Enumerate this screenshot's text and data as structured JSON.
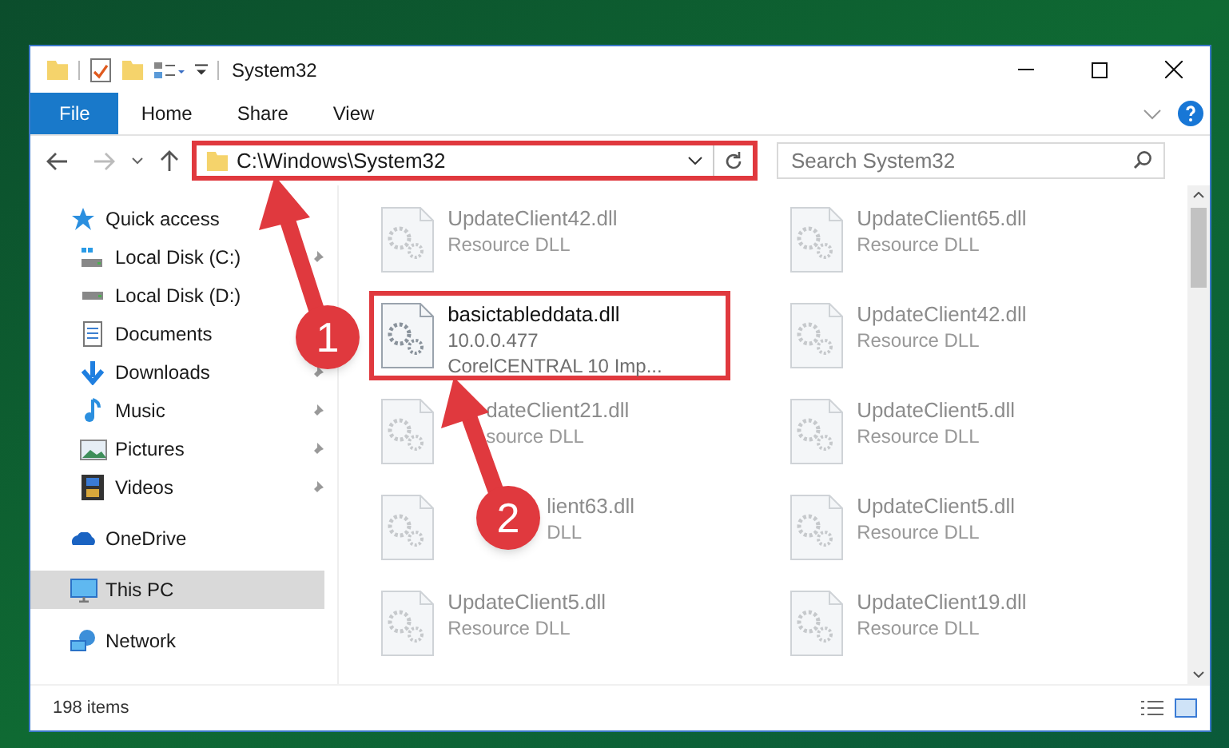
{
  "window": {
    "title": "System32"
  },
  "file_menu": {
    "label": "File"
  },
  "ribbon_tabs": [
    {
      "label": "Home",
      "selected": false
    },
    {
      "label": "Share",
      "selected": false
    },
    {
      "label": "View",
      "selected": false
    }
  ],
  "address_bar": {
    "path": "C:\\Windows\\System32",
    "highlighted": true
  },
  "search": {
    "placeholder": "Search System32"
  },
  "navigation": [
    {
      "label": "Quick access",
      "kind": "star",
      "selected": false,
      "children": [
        {
          "label": "Local Disk (C:)",
          "kind": "system_drive",
          "pinned": true,
          "selected": false
        },
        {
          "label": "Local Disk (D:)",
          "kind": "drive",
          "pinned": false,
          "selected": false
        },
        {
          "label": "Documents",
          "kind": "documents",
          "pinned": false,
          "selected": false
        },
        {
          "label": "Downloads",
          "kind": "downloads",
          "pinned": true,
          "selected": false
        },
        {
          "label": "Music",
          "kind": "music",
          "pinned": true,
          "selected": false
        },
        {
          "label": "Pictures",
          "kind": "pictures",
          "pinned": true,
          "selected": false
        },
        {
          "label": "Videos",
          "kind": "videos",
          "pinned": true,
          "selected": false
        }
      ]
    },
    {
      "label": "OneDrive",
      "kind": "cloud",
      "selected": false
    },
    {
      "label": "This PC",
      "kind": "computer",
      "selected": true
    },
    {
      "label": "Network",
      "kind": "network",
      "selected": false
    }
  ],
  "files": [
    {
      "name": "UpdateClient42.dll",
      "lines": [
        "Resource DLL"
      ],
      "blurred": true,
      "highlighted": false
    },
    {
      "name": "UpdateClient65.dll",
      "lines": [
        "Resource DLL"
      ],
      "blurred": true,
      "highlighted": false
    },
    {
      "name": "basictableddata.dll",
      "lines": [
        "10.0.0.477",
        "CorelCENTRAL 10 Imp..."
      ],
      "blurred": false,
      "highlighted": true
    },
    {
      "name": "UpdateClient42.dll",
      "lines": [
        "Resource DLL"
      ],
      "blurred": true,
      "highlighted": false
    },
    {
      "name": "dateClient21.dll",
      "lines": [
        "source DLL"
      ],
      "blurred": true,
      "highlighted": false
    },
    {
      "name": "UpdateClient5.dll",
      "lines": [
        "Resource DLL"
      ],
      "blurred": true,
      "highlighted": false
    },
    {
      "name": "lient63.dll",
      "lines": [
        "DLL"
      ],
      "blurred": true,
      "highlighted": false
    },
    {
      "name": "UpdateClient5.dll",
      "lines": [
        "Resource DLL"
      ],
      "blurred": true,
      "highlighted": false
    },
    {
      "name": "UpdateClient5.dll",
      "lines": [
        "Resource DLL"
      ],
      "blurred": true,
      "highlighted": false
    },
    {
      "name": "UpdateClient19.dll",
      "lines": [
        "Resource DLL"
      ],
      "blurred": true,
      "highlighted": false
    }
  ],
  "status_bar": {
    "item_count": "198 items"
  },
  "callouts": [
    {
      "label": "1"
    },
    {
      "label": "2"
    }
  ]
}
